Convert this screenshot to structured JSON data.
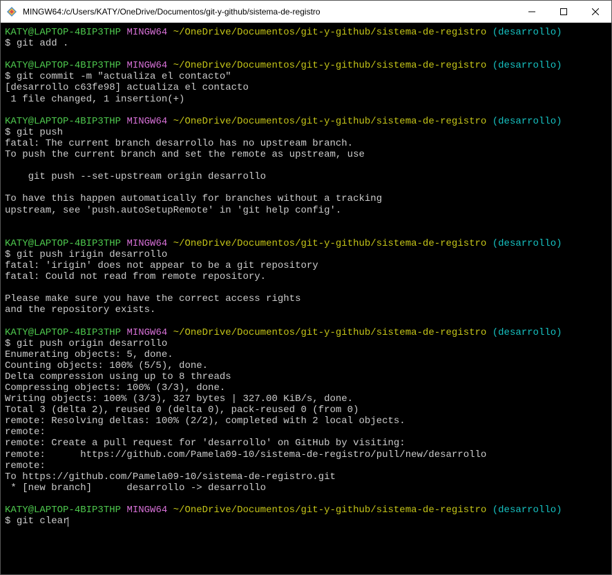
{
  "titlebar": {
    "title": "MINGW64:/c/Users/KATY/OneDrive/Documentos/git-y-github/sistema-de-registro"
  },
  "prompt": {
    "user_host": "KATY@LAPTOP-4BIP3THP",
    "env": "MINGW64",
    "path": "~/OneDrive/Documentos/git-y-github/sistema-de-registro",
    "branch_open": "(",
    "branch": "desarrollo",
    "branch_close": ")",
    "dollar": "$"
  },
  "blocks": [
    {
      "cmd": "git add .",
      "out": []
    },
    {
      "cmd": "git commit -m \"actualiza el contacto\"",
      "out": [
        "[desarrollo c63fe98] actualiza el contacto",
        " 1 file changed, 1 insertion(+)"
      ]
    },
    {
      "cmd": "git push",
      "out": [
        "fatal: The current branch desarrollo has no upstream branch.",
        "To push the current branch and set the remote as upstream, use",
        "",
        "    git push --set-upstream origin desarrollo",
        "",
        "To have this happen automatically for branches without a tracking",
        "upstream, see 'push.autoSetupRemote' in 'git help config'.",
        ""
      ]
    },
    {
      "cmd": "git push irigin desarrollo",
      "out": [
        "fatal: 'irigin' does not appear to be a git repository",
        "fatal: Could not read from remote repository.",
        "",
        "Please make sure you have the correct access rights",
        "and the repository exists."
      ]
    },
    {
      "cmd": "git push origin desarrollo",
      "out": [
        "Enumerating objects: 5, done.",
        "Counting objects: 100% (5/5), done.",
        "Delta compression using up to 8 threads",
        "Compressing objects: 100% (3/3), done.",
        "Writing objects: 100% (3/3), 327 bytes | 327.00 KiB/s, done.",
        "Total 3 (delta 2), reused 0 (delta 0), pack-reused 0 (from 0)",
        "remote: Resolving deltas: 100% (2/2), completed with 2 local objects.",
        "remote:",
        "remote: Create a pull request for 'desarrollo' on GitHub by visiting:",
        "remote:      https://github.com/Pamela09-10/sistema-de-registro/pull/new/desarrollo",
        "remote:",
        "To https://github.com/Pamela09-10/sistema-de-registro.git",
        " * [new branch]      desarrollo -> desarrollo"
      ]
    },
    {
      "cmd": "git clear",
      "out": [],
      "active": true
    }
  ]
}
